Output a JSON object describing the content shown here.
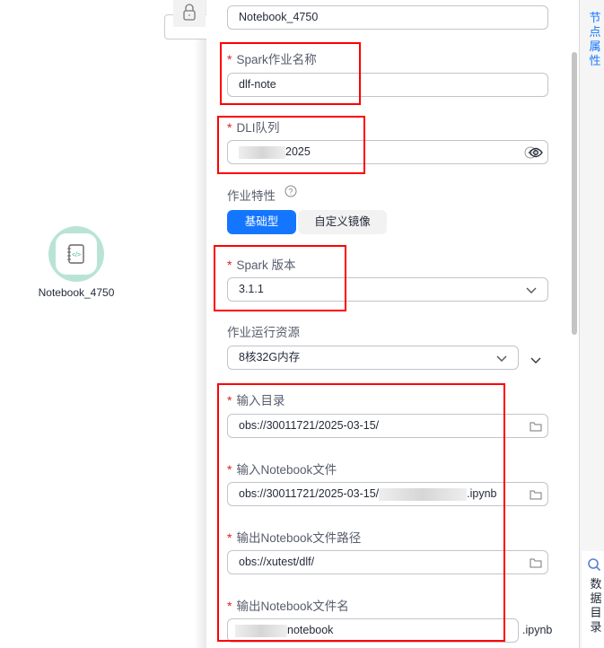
{
  "canvas": {
    "node_label": "Notebook_4750"
  },
  "form": {
    "node_name": "Notebook_4750",
    "spark_job_name": {
      "label": "Spark作业名称",
      "value": "dlf-note"
    },
    "dli_queue": {
      "label": "DLI队列",
      "value_suffix": "2025"
    },
    "job_feature": {
      "label": "作业特性",
      "options": [
        "基础型",
        "自定义镜像"
      ],
      "selected": "基础型"
    },
    "spark_version": {
      "label": "Spark 版本",
      "value": "3.1.1"
    },
    "resources": {
      "label": "作业运行资源",
      "value": "8核32G内存"
    },
    "input_dir": {
      "label": "输入目录",
      "value": "obs://30011721/2025-03-15/"
    },
    "input_file": {
      "label": "输入Notebook文件",
      "value_prefix": "obs://30011721/2025-03-15/",
      "value_suffix": ".ipynb"
    },
    "output_path": {
      "label": "输出Notebook文件路径",
      "value": "obs://xutest/dlf/"
    },
    "output_name": {
      "label": "输出Notebook文件名",
      "value_suffix": "notebook",
      "ext": ".ipynb"
    }
  },
  "rail": {
    "node_props": "节点属性",
    "data_catalog": "数据目录"
  },
  "colors": {
    "primary": "#1476ff",
    "highlight": "#ff0000"
  }
}
